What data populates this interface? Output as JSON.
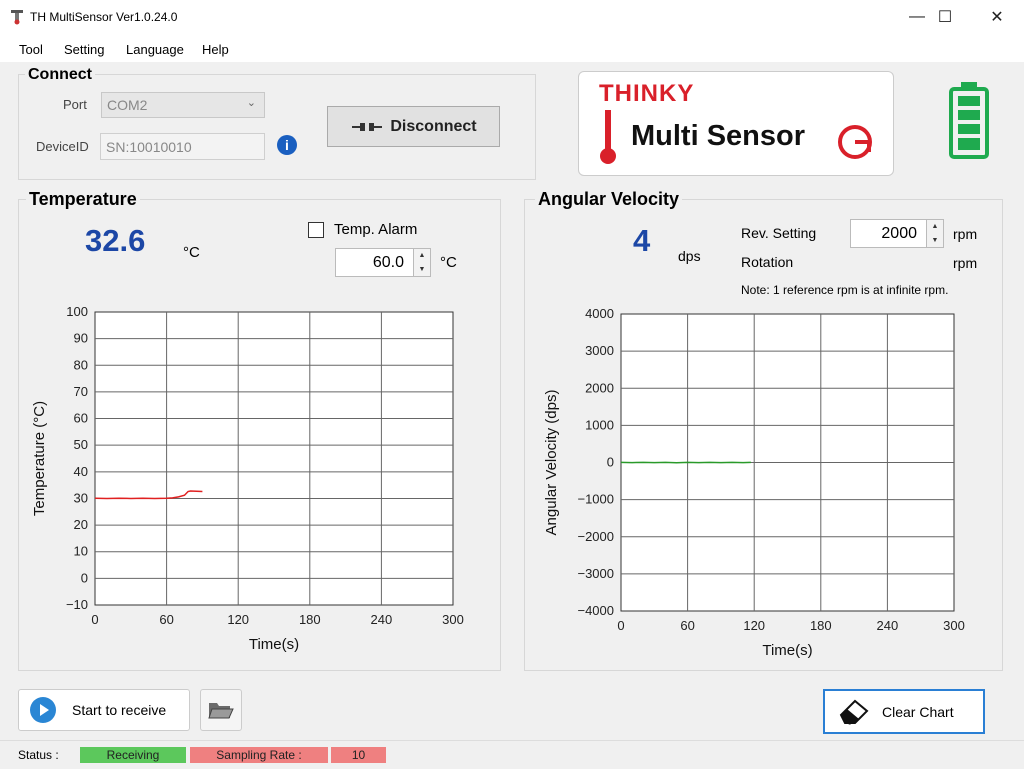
{
  "window": {
    "title": "TH MultiSensor Ver1.0.24.0"
  },
  "menu": [
    "Tool",
    "Setting",
    "Language",
    "Help"
  ],
  "connect": {
    "title": "Connect",
    "port_label": "Port",
    "port_value": "COM2",
    "device_label": "DeviceID",
    "device_value": "SN:10010010",
    "disconnect_label": "Disconnect"
  },
  "logo": {
    "brand": "THINKY",
    "product": "Multi Sensor"
  },
  "battery": {
    "level": 1.0,
    "color": "#1faa4f"
  },
  "temperature": {
    "title": "Temperature",
    "value": "32.6",
    "unit": "°C",
    "alarm_label": "Temp. Alarm",
    "alarm_checked": false,
    "alarm_value": "60.0",
    "alarm_unit": "°C"
  },
  "angular": {
    "title": "Angular Velocity",
    "value": "4",
    "unit": "dps",
    "rev_label": "Rev. Setting",
    "rev_value": "2000",
    "rev_unit": "rpm",
    "rotation_label": "Rotation",
    "rotation_unit": "rpm",
    "note": "Note: 1 reference rpm is at infinite rpm."
  },
  "chart_data": [
    {
      "type": "line",
      "xlabel": "Time(s)",
      "ylabel": "Temperature (°C)",
      "xlim": [
        0,
        300
      ],
      "ylim": [
        -10,
        100
      ],
      "xticks": [
        0,
        60,
        120,
        180,
        240,
        300
      ],
      "yticks": [
        -10,
        0,
        10,
        20,
        30,
        40,
        50,
        60,
        70,
        80,
        90,
        100
      ],
      "grid": true,
      "series": [
        {
          "color": "#e02020",
          "x": [
            0,
            10,
            20,
            30,
            40,
            50,
            60,
            65,
            70,
            75,
            78,
            80,
            85,
            90
          ],
          "y": [
            30.1,
            30.0,
            30.1,
            30.0,
            30.1,
            30.0,
            30.1,
            30.2,
            30.6,
            31.2,
            32.6,
            32.8,
            32.7,
            32.6
          ]
        }
      ]
    },
    {
      "type": "line",
      "xlabel": "Time(s)",
      "ylabel": "Angular Velocity (dps)",
      "xlim": [
        0,
        300
      ],
      "ylim": [
        -4000,
        4000
      ],
      "xticks": [
        0,
        60,
        120,
        180,
        240,
        300
      ],
      "yticks": [
        -4000,
        -3000,
        -2000,
        -1000,
        0,
        1000,
        2000,
        3000,
        4000
      ],
      "grid": true,
      "series": [
        {
          "color": "#2a9a2a",
          "x": [
            0,
            10,
            20,
            30,
            40,
            50,
            60,
            70,
            80,
            90,
            100,
            110,
            117
          ],
          "y": [
            2,
            -3,
            5,
            -2,
            4,
            -6,
            3,
            -4,
            5,
            -3,
            2,
            -2,
            4
          ]
        }
      ]
    }
  ],
  "bottom": {
    "start_label": "Start to receive",
    "clear_label": "Clear Chart"
  },
  "status": {
    "label": "Status :",
    "state": "Receiving",
    "state_color": "#5cc85c",
    "rate_label": "Sampling Rate :",
    "rate_value": "10",
    "rate_color": "#ef8080"
  }
}
